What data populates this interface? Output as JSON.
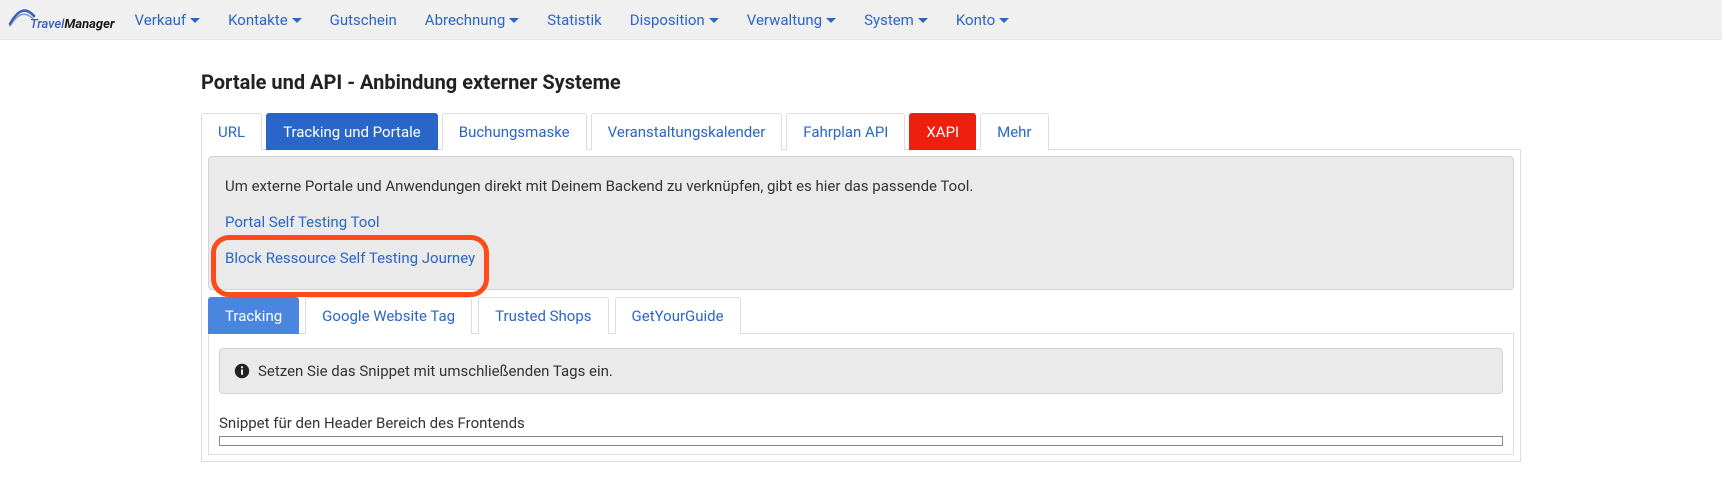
{
  "logo": {
    "part1": "Travel",
    "part2": "Manager"
  },
  "nav": {
    "items": [
      {
        "label": "Verkauf",
        "dropdown": true
      },
      {
        "label": "Kontakte",
        "dropdown": true
      },
      {
        "label": "Gutschein",
        "dropdown": false
      },
      {
        "label": "Abrechnung",
        "dropdown": true
      },
      {
        "label": "Statistik",
        "dropdown": false
      },
      {
        "label": "Disposition",
        "dropdown": true
      },
      {
        "label": "Verwaltung",
        "dropdown": true
      },
      {
        "label": "System",
        "dropdown": true
      },
      {
        "label": "Konto",
        "dropdown": true
      }
    ]
  },
  "page_title": "Portale und API - Anbindung externer Systeme",
  "tabs": [
    {
      "label": "URL"
    },
    {
      "label": "Tracking und Portale",
      "state": "active-blue"
    },
    {
      "label": "Buchungsmaske"
    },
    {
      "label": "Veranstaltungskalender"
    },
    {
      "label": "Fahrplan API"
    },
    {
      "label": "XAPI",
      "state": "active-red"
    },
    {
      "label": "Mehr"
    }
  ],
  "info": {
    "text": "Um externe Portale und Anwendungen direkt mit Deinem Backend zu verknüpfen, gibt es hier das passende Tool.",
    "link1": "Portal Self Testing Tool",
    "link2": "Block Ressource Self Testing Journey"
  },
  "subtabs": [
    {
      "label": "Tracking",
      "active": true
    },
    {
      "label": "Google Website Tag"
    },
    {
      "label": "Trusted Shops"
    },
    {
      "label": "GetYourGuide"
    }
  ],
  "callout": "Setzen Sie das Snippet mit umschließenden Tags ein.",
  "snippet_label": "Snippet für den Header Bereich des Frontends"
}
